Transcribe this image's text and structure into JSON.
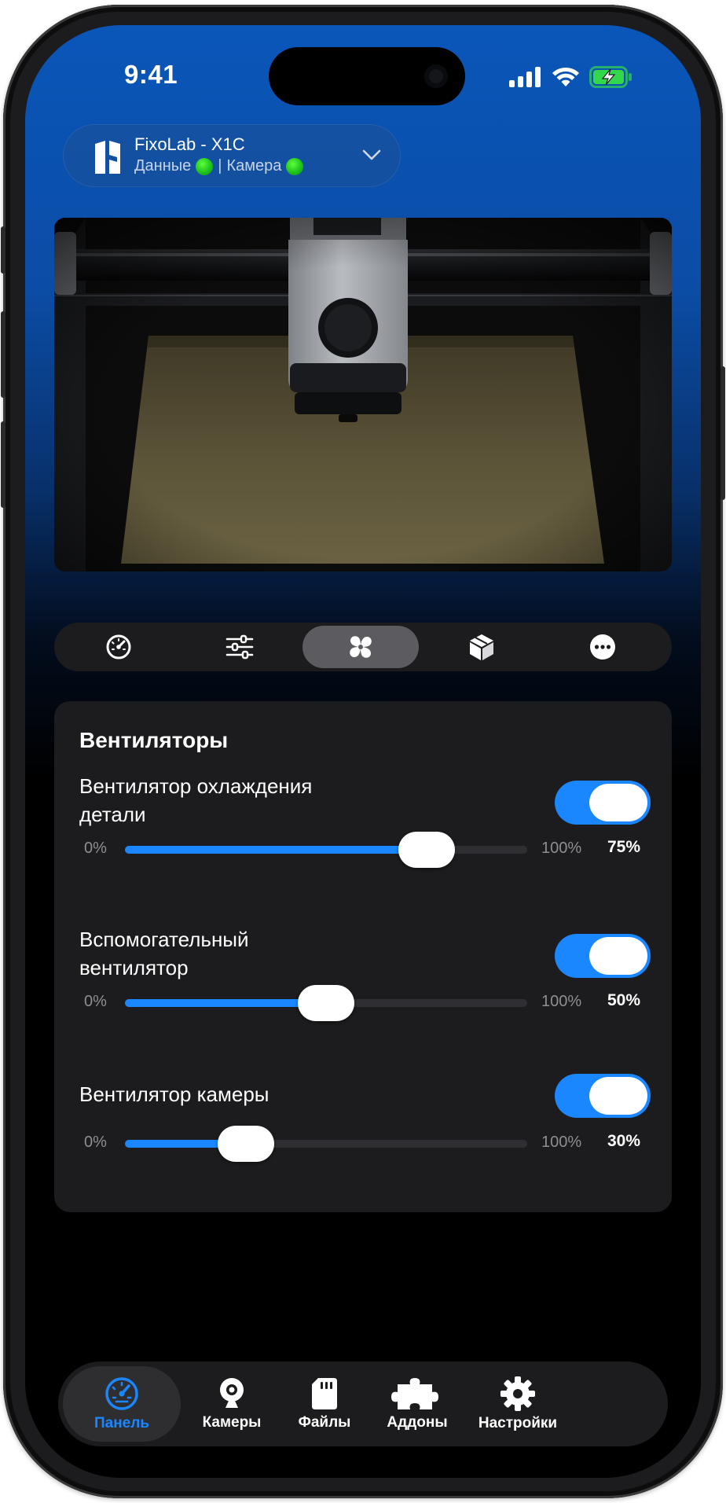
{
  "status_bar": {
    "time": "9:41"
  },
  "printer": {
    "name": "FixoLab - X1C",
    "data_label": "Данные",
    "separator": "|",
    "camera_label": "Камера"
  },
  "control_tabs": [
    {
      "icon": "speedometer-icon",
      "active": false
    },
    {
      "icon": "sliders-icon",
      "active": false
    },
    {
      "icon": "fan-icon",
      "active": true
    },
    {
      "icon": "box-icon",
      "active": false
    },
    {
      "icon": "more-icon",
      "active": false
    }
  ],
  "fans": {
    "title": "Вентиляторы",
    "items": [
      {
        "label": "Вентилятор охлаждения детали",
        "enabled": true,
        "min": "0%",
        "max": "100%",
        "value": 75,
        "value_label": "75%"
      },
      {
        "label": "Вспомогательный вентилятор",
        "enabled": true,
        "min": "0%",
        "max": "100%",
        "value": 50,
        "value_label": "50%"
      },
      {
        "label": "Вентилятор камеры",
        "enabled": true,
        "min": "0%",
        "max": "100%",
        "value": 30,
        "value_label": "30%"
      }
    ]
  },
  "bottom_nav": [
    {
      "label": "Панель",
      "icon": "dashboard-icon",
      "active": true
    },
    {
      "label": "Камеры",
      "icon": "webcam-icon",
      "active": false
    },
    {
      "label": "Файлы",
      "icon": "sd-card-icon",
      "active": false
    },
    {
      "label": "Аддоны",
      "icon": "puzzle-icon",
      "active": false
    },
    {
      "label": "Настройки",
      "icon": "gear-icon",
      "active": false
    }
  ],
  "colors": {
    "accent": "#1a86ff",
    "panel": "#1c1c1e",
    "status_green": "#1ec41c"
  }
}
